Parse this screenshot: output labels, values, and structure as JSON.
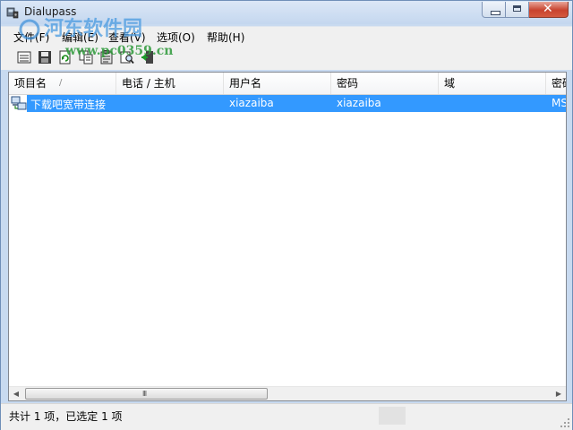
{
  "window": {
    "title": "Dialupass"
  },
  "menu": {
    "items": [
      {
        "label": "文件(F)"
      },
      {
        "label": "编辑(E)"
      },
      {
        "label": "查看(V)"
      },
      {
        "label": "选项(O)"
      },
      {
        "label": "帮助(H)"
      }
    ]
  },
  "list": {
    "columns": [
      "项目名",
      "电话 / 主机",
      "用户名",
      "密码",
      "域",
      "密码"
    ],
    "sort_indicator": "/",
    "rows": [
      {
        "entry_name": "下载吧宽带连接",
        "phone_host": "",
        "user_name": "xiazaiba",
        "password": "xiazaiba",
        "domain": "",
        "password_type": "MS"
      }
    ]
  },
  "scroll": {
    "grip": "III"
  },
  "status": {
    "text": "共计 1 项，已选定 1 项"
  },
  "watermark": {
    "text": "河东软件园",
    "url": "www.pc0359.cn"
  },
  "colors": {
    "selection": "#3399ff",
    "titlebar": "#c4d7ef"
  }
}
